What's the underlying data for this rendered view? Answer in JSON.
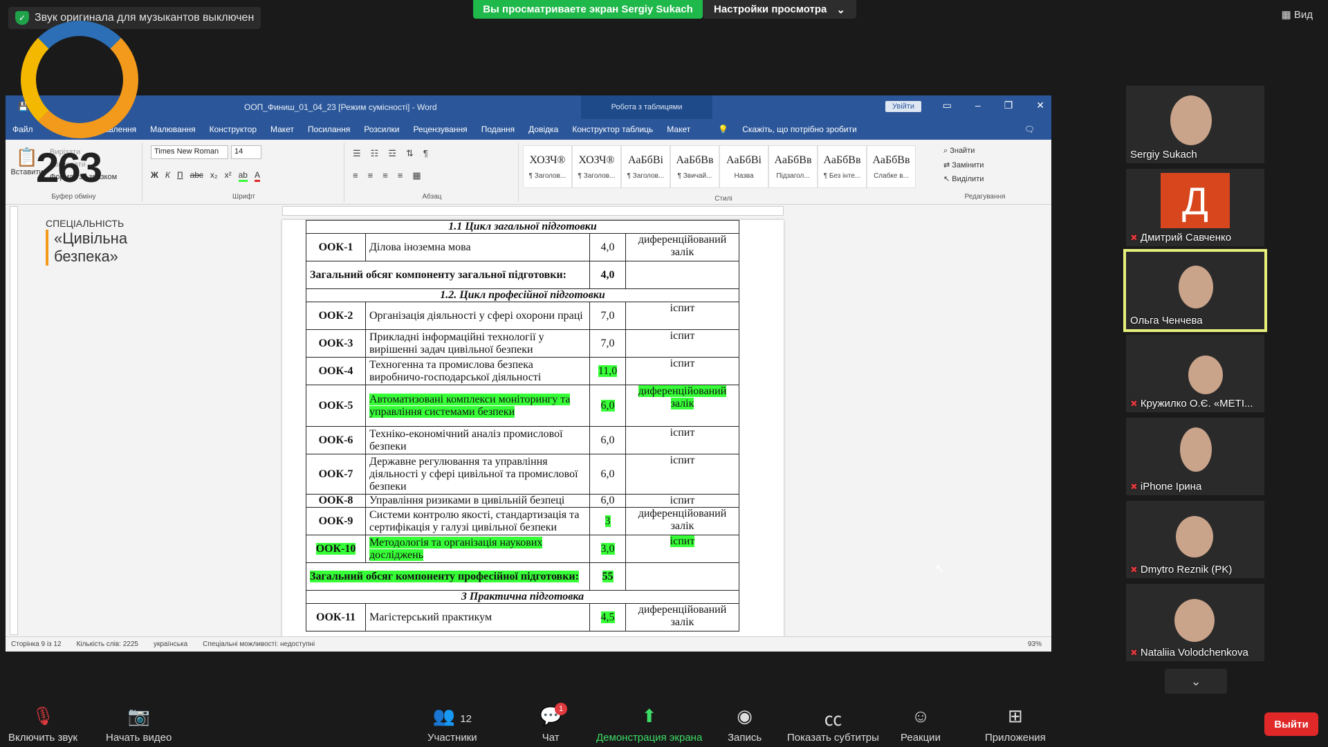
{
  "zoom": {
    "notice": "Звук оригинала для музыкантов выключен",
    "share_banner": "Вы просматриваете экран Sergiy Sukach",
    "view_options": "Настройки просмотра",
    "view_button": "Вид",
    "toolbar": {
      "unmute": "Включить звук",
      "start_video": "Начать видео",
      "participants": "Участники",
      "participants_count": "12",
      "chat": "Чат",
      "chat_badge": "1",
      "share": "Демонстрация экрана",
      "record": "Запись",
      "captions": "Показать субтитры",
      "reactions": "Реакции",
      "apps": "Приложения",
      "leave": "Выйти"
    },
    "participants": [
      {
        "name": "Sergiy Sukach",
        "muted": false
      },
      {
        "name": "Дмитрий Савченко",
        "muted": true,
        "initial": "Д"
      },
      {
        "name": "Ольга Ченчева",
        "muted": false,
        "active": true
      },
      {
        "name": "Кружилко О.Є. «МЕТІ...",
        "muted": true
      },
      {
        "name": "iPhone Ірина",
        "muted": true
      },
      {
        "name": "Dmytro Reznik (PK)",
        "muted": true
      },
      {
        "name": "Nataliia Volodchenkova",
        "muted": true
      }
    ]
  },
  "logo": {
    "number": "263",
    "label": "СПЕЦІАЛЬНІСТЬ",
    "specialty": "«Цивільна безпека»"
  },
  "word": {
    "title": "ООП_Финиш_01_04_23 [Режим сумісності] - Word",
    "context_tab": "Робота з таблицями",
    "signin": "Увійти",
    "tabs": [
      "Файл",
      "Вставлення",
      "Малювання",
      "Конструктор",
      "Макет",
      "Посилання",
      "Розсилки",
      "Рецензування",
      "Подання",
      "Довідка",
      "Конструктор таблиць",
      "Макет"
    ],
    "tell_me": "Скажіть, що потрібно зробити",
    "font": "Times New Roman",
    "font_size": "14",
    "group_labels": {
      "clipboard": "Буфер обміну",
      "font": "Шрифт",
      "paragraph": "Абзац",
      "styles": "Стилі",
      "editing": "Редагування"
    },
    "clipboard": {
      "paste": "Вставити",
      "cut": "Вирізати",
      "copy": "Копіювати",
      "format": "Формат за зразком"
    },
    "styles": [
      {
        "sample": "ХОЗЧ®",
        "name": "¶ Заголов..."
      },
      {
        "sample": "ХОЗЧ®",
        "name": "¶ Заголов..."
      },
      {
        "sample": "АаБбВі",
        "name": "¶ Заголов..."
      },
      {
        "sample": "АаБбВв",
        "name": "¶ Звичай..."
      },
      {
        "sample": "АаБбВі",
        "name": "Назва"
      },
      {
        "sample": "АаБбВв",
        "name": "Підзагол..."
      },
      {
        "sample": "АаБбВв",
        "name": "¶ Без інте..."
      },
      {
        "sample": "АаБбВв",
        "name": "Слабке в..."
      }
    ],
    "editing": {
      "find": "Знайти",
      "replace": "Замінити",
      "select": "Виділити"
    },
    "status": {
      "page": "Сторінка 9 із 12",
      "words": "Кількість слів: 2225",
      "lang": "українська",
      "access": "Спеціальні можливості: недоступні",
      "zoom": "93%"
    },
    "table": {
      "sec1": "1.1 Цикл загальної підготовки",
      "sec2": "1.2. Цикл професійної підготовки",
      "sec3": "3 Практична підготовка",
      "total1_label": "Загальний обсяг компоненту загальної підготовки:",
      "total1_value": "4,0",
      "total2_label": "Загальний обсяг компоненту професійної підготовки:",
      "total2_value": "55",
      "rows": [
        {
          "code": "ООК-1",
          "name": "Ділова іноземна мова",
          "credits": "4,0",
          "control": "диференційований залік"
        },
        {
          "code": "ООК-2",
          "name": "Організація діяльності у сфері охорони праці",
          "credits": "7,0",
          "control": "іспит"
        },
        {
          "code": "ООК-3",
          "name": "Прикладні інформаційні технології у вирішенні задач цивільної безпеки",
          "credits": "7,0",
          "control": "іспит"
        },
        {
          "code": "ООК-4",
          "name": "Техногенна та промислова безпека виробничо-господарської діяльності",
          "credits": "11,0",
          "control": "іспит"
        },
        {
          "code": "ООК-5",
          "name": "Автоматизовані комплекси моніторингу та управління системами безпеки",
          "credits": "6,0",
          "control": "диференційований залік"
        },
        {
          "code": "ООК-6",
          "name": "Техніко-економічний аналіз промислової безпеки",
          "credits": "6,0",
          "control": "іспит"
        },
        {
          "code": "ООК-7",
          "name": "Державне регулювання та управління діяльності у сфері цивільної та промислової безпеки",
          "credits": "6,0",
          "control": "іспит"
        },
        {
          "code": "ООК-8",
          "name": "Управління ризиками в цивільній безпеці",
          "credits": "6,0",
          "control": "іспит"
        },
        {
          "code": "ООК-9",
          "name": "Системи контролю якості, стандартизація та сертифікація у галузі цивільної безпеки",
          "credits": "3",
          "control": "диференційований залік"
        },
        {
          "code": "ООК-10",
          "name": "Методологія та організація наукових досліджень",
          "credits": "3,0",
          "control": "іспит"
        },
        {
          "code": "ООК-11",
          "name": "Магістерський практикум",
          "credits": "4,5",
          "control": "диференційований залік"
        }
      ]
    }
  },
  "colors": {
    "word_blue": "#2b579a",
    "zoom_green": "#1fb84a",
    "highlight": "#37ff37",
    "leave_red": "#e02828"
  }
}
